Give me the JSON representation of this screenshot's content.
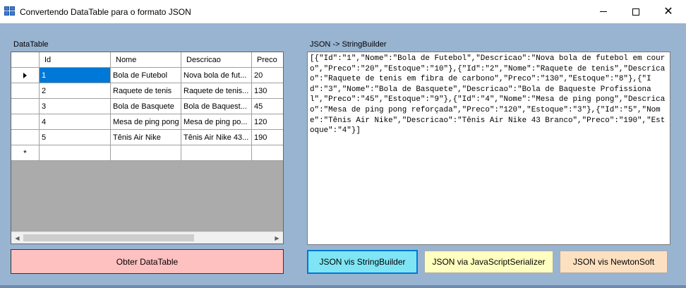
{
  "window": {
    "title": "Convertendo DataTable para o formato JSON"
  },
  "labels": {
    "datatable": "DataTable",
    "json_sb": "JSON -> StringBuilder"
  },
  "grid": {
    "columns": [
      "Id",
      "Nome",
      "Descricao",
      "Preco"
    ],
    "rows": [
      [
        "1",
        "Bola de Futebol",
        "Nova bola de fut...",
        "20"
      ],
      [
        "2",
        "Raquete de tenis",
        "Raquete de tenis...",
        "130"
      ],
      [
        "3",
        "Bola de Basquete",
        "Bola de Baquest...",
        "45"
      ],
      [
        "4",
        "Mesa de ping pong",
        "Mesa de ping po...",
        "120"
      ],
      [
        "5",
        "Tênis Air Nike",
        "Tênis Air Nike 43...",
        "190"
      ]
    ],
    "new_row_marker": "*"
  },
  "json_output": "[{\"Id\":\"1\",\"Nome\":\"Bola de Futebol\",\"Descricao\":\"Nova bola de futebol em couro\",\"Preco\":\"20\",\"Estoque\":\"10\"},{\"Id\":\"2\",\"Nome\":\"Raquete de tenis\",\"Descricao\":\"Raquete de tenis em fibra de carbono\",\"Preco\":\"130\",\"Estoque\":\"8\"},{\"Id\":\"3\",\"Nome\":\"Bola de Basquete\",\"Descricao\":\"Bola de Baqueste Profissional\",\"Preco\":\"45\",\"Estoque\":\"9\"},{\"Id\":\"4\",\"Nome\":\"Mesa de ping pong\",\"Descricao\":\"Mesa de ping pong reforçada\",\"Preco\":\"120\",\"Estoque\":\"3\"},{\"Id\":\"5\",\"Nome\":\"Tênis Air Nike\",\"Descricao\":\"Tênis Air Nike 43 Branco\",\"Preco\":\"190\",\"Estoque\":\"4\"}]",
  "buttons": {
    "obter": "Obter DataTable",
    "stringbuilder": "JSON vis StringBuilder",
    "jsserializer": "JSON via JavaScriptSerializer",
    "newtonsoft": "JSON vis NewtonSoft"
  },
  "icons": {
    "minimize": "minimize-icon",
    "maximize": "maximize-icon",
    "close": "close-icon"
  },
  "colors": {
    "form_bg": "#99b4d1",
    "selected_cell": "#0078d7",
    "btn_obter": "#ffc0c0",
    "btn_stringbuilder": "#7fe5f5",
    "btn_jsserializer": "#ffffc0",
    "btn_newtonsoft": "#fde0c0"
  }
}
